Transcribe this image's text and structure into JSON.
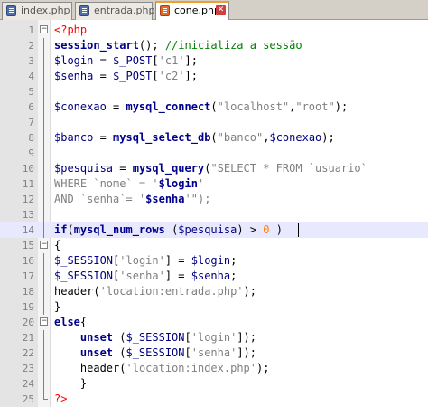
{
  "tabs": [
    {
      "label": "index.php",
      "active": false
    },
    {
      "label": "entrada.php",
      "active": false
    },
    {
      "label": "cone.php",
      "active": true
    }
  ],
  "line_numbers": [
    "1",
    "2",
    "3",
    "4",
    "5",
    "6",
    "7",
    "8",
    "9",
    "10",
    "11",
    "12",
    "13",
    "14",
    "15",
    "16",
    "17",
    "18",
    "19",
    "20",
    "21",
    "22",
    "23",
    "24",
    "25"
  ],
  "lines": [
    [
      {
        "t": "<?php",
        "c": "php"
      }
    ],
    [
      {
        "t": "session_start",
        "c": "kw"
      },
      {
        "t": "(); ",
        "c": ""
      },
      {
        "t": "//inicializa a sessão",
        "c": "cmt"
      }
    ],
    [
      {
        "t": "$login",
        "c": "var"
      },
      {
        "t": " = ",
        "c": ""
      },
      {
        "t": "$_POST",
        "c": "var"
      },
      {
        "t": "[",
        "c": ""
      },
      {
        "t": "'c1'",
        "c": "str"
      },
      {
        "t": "];",
        "c": ""
      }
    ],
    [
      {
        "t": "$senha",
        "c": "var"
      },
      {
        "t": " = ",
        "c": ""
      },
      {
        "t": "$_POST",
        "c": "var"
      },
      {
        "t": "[",
        "c": ""
      },
      {
        "t": "'c2'",
        "c": "str"
      },
      {
        "t": "];",
        "c": ""
      }
    ],
    [],
    [
      {
        "t": "$conexao",
        "c": "var"
      },
      {
        "t": " = ",
        "c": ""
      },
      {
        "t": "mysql_connect",
        "c": "kw"
      },
      {
        "t": "(",
        "c": ""
      },
      {
        "t": "\"localhost\"",
        "c": "str"
      },
      {
        "t": ",",
        "c": ""
      },
      {
        "t": "\"root\"",
        "c": "str"
      },
      {
        "t": ");",
        "c": ""
      }
    ],
    [],
    [
      {
        "t": "$banco",
        "c": "var"
      },
      {
        "t": " = ",
        "c": ""
      },
      {
        "t": "mysql_select_db",
        "c": "kw"
      },
      {
        "t": "(",
        "c": ""
      },
      {
        "t": "\"banco\"",
        "c": "str"
      },
      {
        "t": ",",
        "c": ""
      },
      {
        "t": "$conexao",
        "c": "var"
      },
      {
        "t": ");",
        "c": ""
      }
    ],
    [],
    [
      {
        "t": "$pesquisa",
        "c": "var"
      },
      {
        "t": " = ",
        "c": ""
      },
      {
        "t": "mysql_query",
        "c": "kw"
      },
      {
        "t": "(",
        "c": ""
      },
      {
        "t": "\"SELECT * FROM `usuario`",
        "c": "sql"
      }
    ],
    [
      {
        "t": "WHERE `nome` = '",
        "c": "sql"
      },
      {
        "t": "$login",
        "c": "kw"
      },
      {
        "t": "'",
        "c": "sql"
      }
    ],
    [
      {
        "t": "AND `senha`= '",
        "c": "sql"
      },
      {
        "t": "$senha",
        "c": "kw"
      },
      {
        "t": "'\");",
        "c": "sql"
      }
    ],
    [],
    [
      {
        "t": "if",
        "c": "kw"
      },
      {
        "t": "(",
        "c": ""
      },
      {
        "t": "mysql_num_rows",
        "c": "kw"
      },
      {
        "t": " (",
        "c": ""
      },
      {
        "t": "$pesquisa",
        "c": "var"
      },
      {
        "t": ") > ",
        "c": ""
      },
      {
        "t": "0",
        "c": "num"
      },
      {
        "t": " )",
        "c": ""
      }
    ],
    [
      {
        "t": "{",
        "c": ""
      }
    ],
    [
      {
        "t": "$_SESSION",
        "c": "var"
      },
      {
        "t": "[",
        "c": ""
      },
      {
        "t": "'login'",
        "c": "str"
      },
      {
        "t": "] = ",
        "c": ""
      },
      {
        "t": "$login",
        "c": "var"
      },
      {
        "t": ";",
        "c": ""
      }
    ],
    [
      {
        "t": "$_SESSION",
        "c": "var"
      },
      {
        "t": "[",
        "c": ""
      },
      {
        "t": "'senha'",
        "c": "str"
      },
      {
        "t": "] = ",
        "c": ""
      },
      {
        "t": "$senha",
        "c": "var"
      },
      {
        "t": ";",
        "c": ""
      }
    ],
    [
      {
        "t": "header",
        "c": ""
      },
      {
        "t": "(",
        "c": ""
      },
      {
        "t": "'location:entrada.php'",
        "c": "str"
      },
      {
        "t": ");",
        "c": ""
      }
    ],
    [
      {
        "t": "}",
        "c": ""
      }
    ],
    [
      {
        "t": "else",
        "c": "kw"
      },
      {
        "t": "{",
        "c": ""
      }
    ],
    [
      {
        "t": "    ",
        "c": ""
      },
      {
        "t": "unset",
        "c": "kw"
      },
      {
        "t": " (",
        "c": ""
      },
      {
        "t": "$_SESSION",
        "c": "var"
      },
      {
        "t": "[",
        "c": ""
      },
      {
        "t": "'login'",
        "c": "str"
      },
      {
        "t": "]);",
        "c": ""
      }
    ],
    [
      {
        "t": "    ",
        "c": ""
      },
      {
        "t": "unset",
        "c": "kw"
      },
      {
        "t": " (",
        "c": ""
      },
      {
        "t": "$_SESSION",
        "c": "var"
      },
      {
        "t": "[",
        "c": ""
      },
      {
        "t": "'senha'",
        "c": "str"
      },
      {
        "t": "]);",
        "c": ""
      }
    ],
    [
      {
        "t": "    ",
        "c": ""
      },
      {
        "t": "header",
        "c": ""
      },
      {
        "t": "(",
        "c": ""
      },
      {
        "t": "'location:index.php'",
        "c": "str"
      },
      {
        "t": ");",
        "c": ""
      }
    ],
    [
      {
        "t": "    }",
        "c": ""
      }
    ],
    [
      {
        "t": "?>",
        "c": "php"
      }
    ]
  ],
  "colors": {
    "keyword": "#00008a",
    "php_tag": "#ff0000",
    "comment": "#008000",
    "string": "#808080",
    "number": "#ff8000",
    "current_line": "#e8e8ff"
  },
  "current_line": 14
}
